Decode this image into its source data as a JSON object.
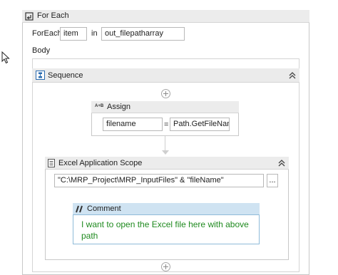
{
  "foreach": {
    "title": "For Each",
    "label_foreach": "ForEach",
    "item_value": "item",
    "label_in": "in",
    "collection_value": "out_filepatharray",
    "body_label": "Body"
  },
  "sequence": {
    "title": "Sequence"
  },
  "assign": {
    "icon_text": "A+B",
    "title": "Assign",
    "target_value": "filename",
    "equals": "=",
    "expression_value": "Path.GetFileName("
  },
  "excel_scope": {
    "title": "Excel Application Scope",
    "path_value": "\"C:\\MRP_Project\\MRP_InputFiles\" & \"fileName\"",
    "browse_label": "..."
  },
  "comment": {
    "title": "Comment",
    "text": "I want to open the Excel file here with above path"
  },
  "icons": {
    "foreach": "foreach-icon",
    "sequence": "sequence-icon",
    "assign": "assign-icon",
    "excel": "excel-scope-icon",
    "comment": "comment-icon",
    "collapse": "double-chevron-up-icon",
    "add": "plus-circle-icon",
    "cursor": "mouse-cursor-icon"
  },
  "colors": {
    "comment_text": "#1f8a1f",
    "comment_header": "#cfe3f2",
    "sequence_icon": "#2b6cb0"
  }
}
